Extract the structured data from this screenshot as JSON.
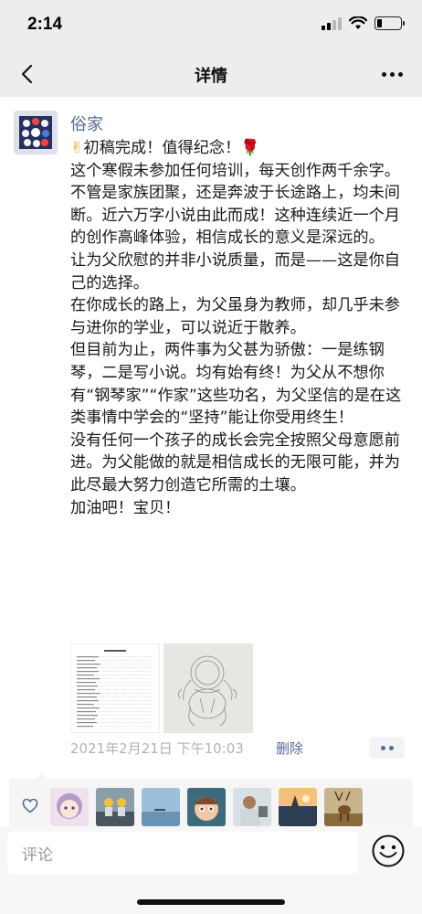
{
  "status_bar": {
    "time": "2:14",
    "battery_level": 0.2
  },
  "nav": {
    "title": "详情",
    "back_icon": "chevron-left-icon",
    "more_icon": "more-dots-icon"
  },
  "post": {
    "author": "俗家",
    "title_line": "初稿完成！值得纪念！",
    "title_emoji_left": "✌",
    "title_emoji_right": "🌹",
    "paragraphs": [
      "这个寒假未参加任何培训，每天创作两千余字。不管是家族团聚，还是奔波于长途路上，均未间断。近六万字小说由此而成！这种连续近一个月的创作高峰体验，相信成长的意义是深远的。",
      "让为父欣慰的并非小说质量，而是——这是你自己的选择。",
      "在你成长的路上，为父虽身为教师，却几乎未参与进你的学业，可以说近于散养。",
      "但目前为止，两件事为父甚为骄傲：一是练钢琴，二是写小说。均有始有终！为父从不想你有“钢琴家”“作家”这些功名，为父坚信的是在这类事情中学会的“坚持”能让你受用终生！",
      "没有任何一个孩子的成长会完全按照父母意愿前进。为父能做的就是相信成长的无限可能，并为此尽最大努力创造它所需的土壤。",
      "加油吧！宝贝！"
    ],
    "images": [
      "document-thumbnail",
      "sketch-thumbnail"
    ],
    "timestamp": "2021年2月21日 下午10:03",
    "delete_label": "删除"
  },
  "likes": {
    "icon": "heart-icon",
    "avatars": [
      "avatar-1",
      "avatar-2",
      "avatar-3",
      "avatar-4",
      "avatar-5",
      "avatar-6",
      "avatar-7"
    ]
  },
  "comment_bar": {
    "placeholder": "评论",
    "emoji_icon": "smiley-icon"
  }
}
